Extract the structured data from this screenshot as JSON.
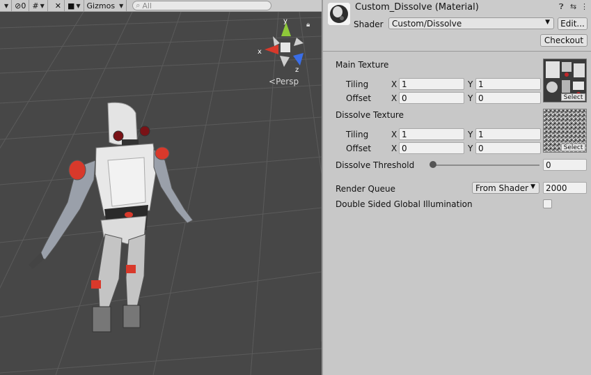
{
  "toolbar": {
    "hidden_count": "0",
    "gizmos_label": "Gizmos",
    "search_placeholder": "All"
  },
  "scene": {
    "view_mode": "Persp",
    "axis_x": "x",
    "axis_y": "y",
    "axis_z": "z",
    "colors": {
      "background": "#474747",
      "grid": "#5a5a5a",
      "x_axis": "#d8392b",
      "y_axis": "#8fc93a",
      "z_axis": "#3a6ee8"
    }
  },
  "inspector": {
    "title": "Custom_Dissolve (Material)",
    "shader_label": "Shader",
    "shader_value": "Custom/Dissolve",
    "edit_label": "Edit...",
    "checkout_label": "Checkout",
    "main_texture": {
      "label": "Main Texture",
      "tiling_label": "Tiling",
      "offset_label": "Offset",
      "x_label": "X",
      "y_label": "Y",
      "tiling_x": "1",
      "tiling_y": "1",
      "offset_x": "0",
      "offset_y": "0",
      "select_label": "Select"
    },
    "dissolve_texture": {
      "label": "Dissolve Texture",
      "tiling_label": "Tiling",
      "offset_label": "Offset",
      "x_label": "X",
      "y_label": "Y",
      "tiling_x": "1",
      "tiling_y": "1",
      "offset_x": "0",
      "offset_y": "0",
      "select_label": "Select"
    },
    "dissolve_threshold": {
      "label": "Dissolve Threshold",
      "value": "0",
      "slider_fraction": 0
    },
    "render_queue": {
      "label": "Render Queue",
      "mode": "From Shader",
      "value": "2000"
    },
    "double_sided_gi": {
      "label": "Double Sided Global Illumination",
      "checked": false
    }
  }
}
